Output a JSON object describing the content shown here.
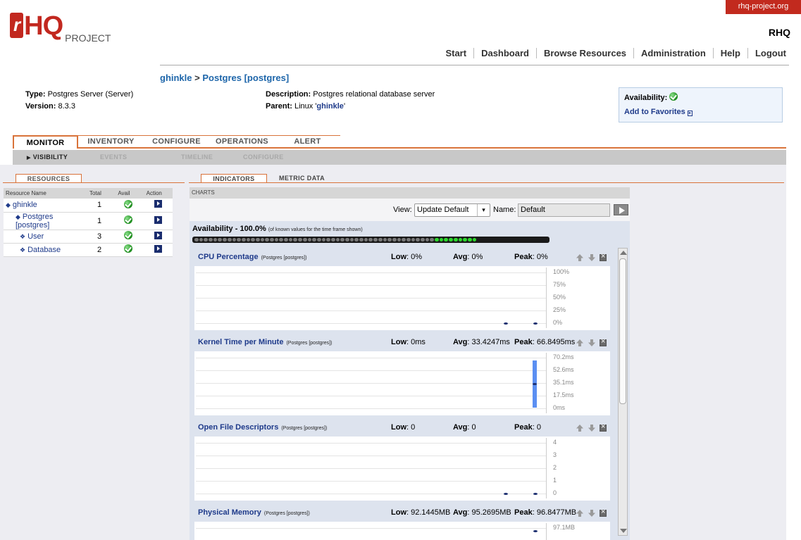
{
  "header": {
    "project_link": "rhq-project.org",
    "logo_r": "r",
    "logo_hq": "HQ",
    "logo_project": "PROJECT",
    "app_name": "RHQ",
    "nav": [
      "Start",
      "Dashboard",
      "Browse Resources",
      "Administration",
      "Help",
      "Logout"
    ]
  },
  "breadcrumb": {
    "parent": "ghinkle",
    "separator": ">",
    "current": "Postgres [postgres]"
  },
  "info": {
    "type_label": "Type:",
    "type_value": "Postgres Server (Server)",
    "version_label": "Version:",
    "version_value": "8.3.3",
    "description_label": "Description:",
    "description_value": "Postgres relational database server",
    "parent_label": "Parent:",
    "parent_prefix": "Linux '",
    "parent_link": "ghinkle",
    "parent_suffix": "'"
  },
  "availability_box": {
    "label": "Availability:",
    "favorites": "Add to Favorites",
    "status_icon": "check-icon"
  },
  "tabs": [
    "MONITOR",
    "INVENTORY",
    "CONFIGURE",
    "OPERATIONS",
    "ALERT"
  ],
  "active_tab": "MONITOR",
  "subtabs": [
    "VISIBILITY",
    "EVENTS",
    "TIMELINE",
    "CONFIGURE"
  ],
  "active_subtab": "VISIBILITY",
  "resources": {
    "tab": "RESOURCES",
    "columns": [
      "Resource Name",
      "Total",
      "Avail",
      "Action"
    ],
    "rows": [
      {
        "name": "ghinkle",
        "total": "1"
      },
      {
        "name": "Postgres [postgres]",
        "total": "1"
      },
      {
        "name": "User",
        "total": "3"
      },
      {
        "name": "Database",
        "total": "2"
      }
    ]
  },
  "indicators": {
    "tab": "INDICATORS",
    "tab2": "METRIC DATA",
    "charts_header": "CHARTS",
    "view_label": "View:",
    "view_value": "Update Default",
    "name_label": "Name:",
    "name_value": "Default",
    "availability_title": "Availability - 100.0%",
    "availability_note": "(of known values for the time frame shown)",
    "availability_dots_total": 60,
    "availability_dots_up": 9
  },
  "metrics": [
    {
      "title": "CPU Percentage",
      "sub": "(Postgres [postgres])",
      "low": "0%",
      "avg": "0%",
      "peak": "0%",
      "ticks": [
        "100%",
        "75%",
        "50%",
        "25%",
        "0%"
      ]
    },
    {
      "title": "Kernel Time per Minute",
      "sub": "(Postgres [postgres])",
      "low": "0ms",
      "avg": "33.4247ms",
      "peak": "66.8495ms",
      "ticks": [
        "70.2ms",
        "52.6ms",
        "35.1ms",
        "17.5ms",
        "0ms"
      ]
    },
    {
      "title": "Open File Descriptors",
      "sub": "(Postgres [postgres])",
      "low": "0",
      "avg": "0",
      "peak": "0",
      "ticks": [
        "4",
        "3",
        "2",
        "1",
        "0"
      ]
    },
    {
      "title": "Physical Memory",
      "sub": "(Postgres [postgres])",
      "low": "92.1445MB",
      "avg": "95.2695MB",
      "peak": "96.8477MB",
      "ticks": [
        "97.1MB"
      ]
    }
  ],
  "stat_labels": {
    "low": "Low",
    "avg": "Avg",
    "peak": "Peak"
  },
  "colors": {
    "accent": "#d9733a",
    "brand": "#c2281f",
    "link": "#1e3a8a",
    "bar": "#5b8ff2",
    "up": "#2bd62b"
  }
}
